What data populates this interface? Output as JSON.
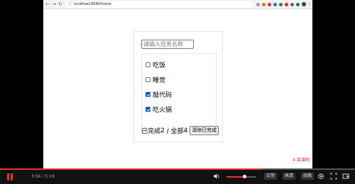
{
  "browser": {
    "url": "localhost:8080/home"
  },
  "app": {
    "input_placeholder": "请输入任务名称",
    "tasks": [
      {
        "label": "吃饭",
        "done": false
      },
      {
        "label": "睡觉",
        "done": false
      },
      {
        "label": "敲代码",
        "done": true
      },
      {
        "label": "吃火锅",
        "done": true
      }
    ],
    "completed_prefix": "已完成",
    "completed_count": "2",
    "separator": " / 全部",
    "total_count": "4",
    "clear_button_label": "清除已完成"
  },
  "watermark": "4 慕课网",
  "player": {
    "time_current": "3:56",
    "time_separator": " / ",
    "time_total": "5:19",
    "progress_fraction": 0.74,
    "volume_fraction": 0.6,
    "quality_options": [
      "正常",
      "高清",
      "线路"
    ],
    "colors": {
      "accent": "#e03a2f"
    }
  }
}
